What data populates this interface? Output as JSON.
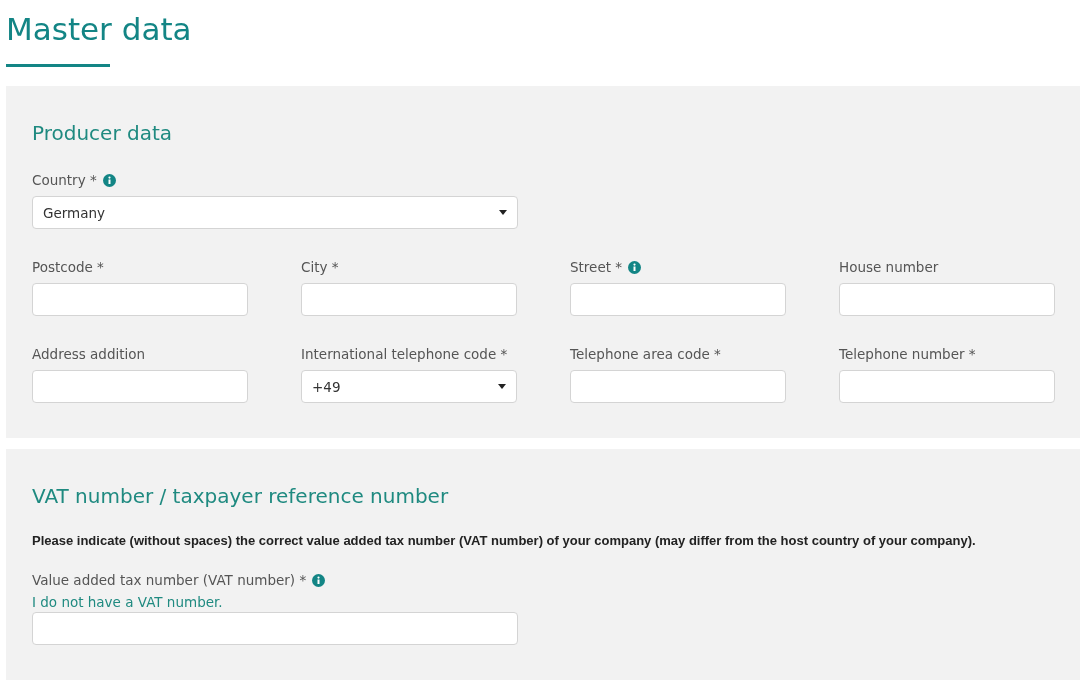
{
  "page_title": "Master data",
  "sections": [
    {
      "title": "Producer data",
      "rows": [
        [
          {
            "label": "Country *",
            "info": true,
            "kind": "select",
            "value": "Germany",
            "wide": true
          }
        ],
        [
          {
            "label": "Postcode *",
            "info": false,
            "kind": "text",
            "wide": false
          },
          {
            "label": "City *",
            "info": false,
            "kind": "text",
            "wide": false
          },
          {
            "label": "Street *",
            "info": true,
            "kind": "text",
            "wide": false
          },
          {
            "label": "House number",
            "info": false,
            "kind": "text",
            "wide": false
          }
        ],
        [
          {
            "label": "Address addition",
            "info": false,
            "kind": "text",
            "wide": false
          },
          {
            "label": "International telephone code *",
            "info": false,
            "kind": "select",
            "value": "+49",
            "wide": false
          },
          {
            "label": "Telephone area code *",
            "info": false,
            "kind": "text",
            "wide": false
          },
          {
            "label": "Telephone number *",
            "info": false,
            "kind": "text",
            "wide": false
          }
        ]
      ]
    },
    {
      "title": "VAT number / taxpayer reference number",
      "note": "Please indicate (without spaces) the correct value added tax number (VAT number) of your company (may differ from the host country of your company).",
      "rows": [
        [
          {
            "label": "Value added tax number (VAT number) *",
            "info": true,
            "kind": "text",
            "wide": true,
            "link": "I do not have a VAT number."
          }
        ]
      ]
    }
  ]
}
